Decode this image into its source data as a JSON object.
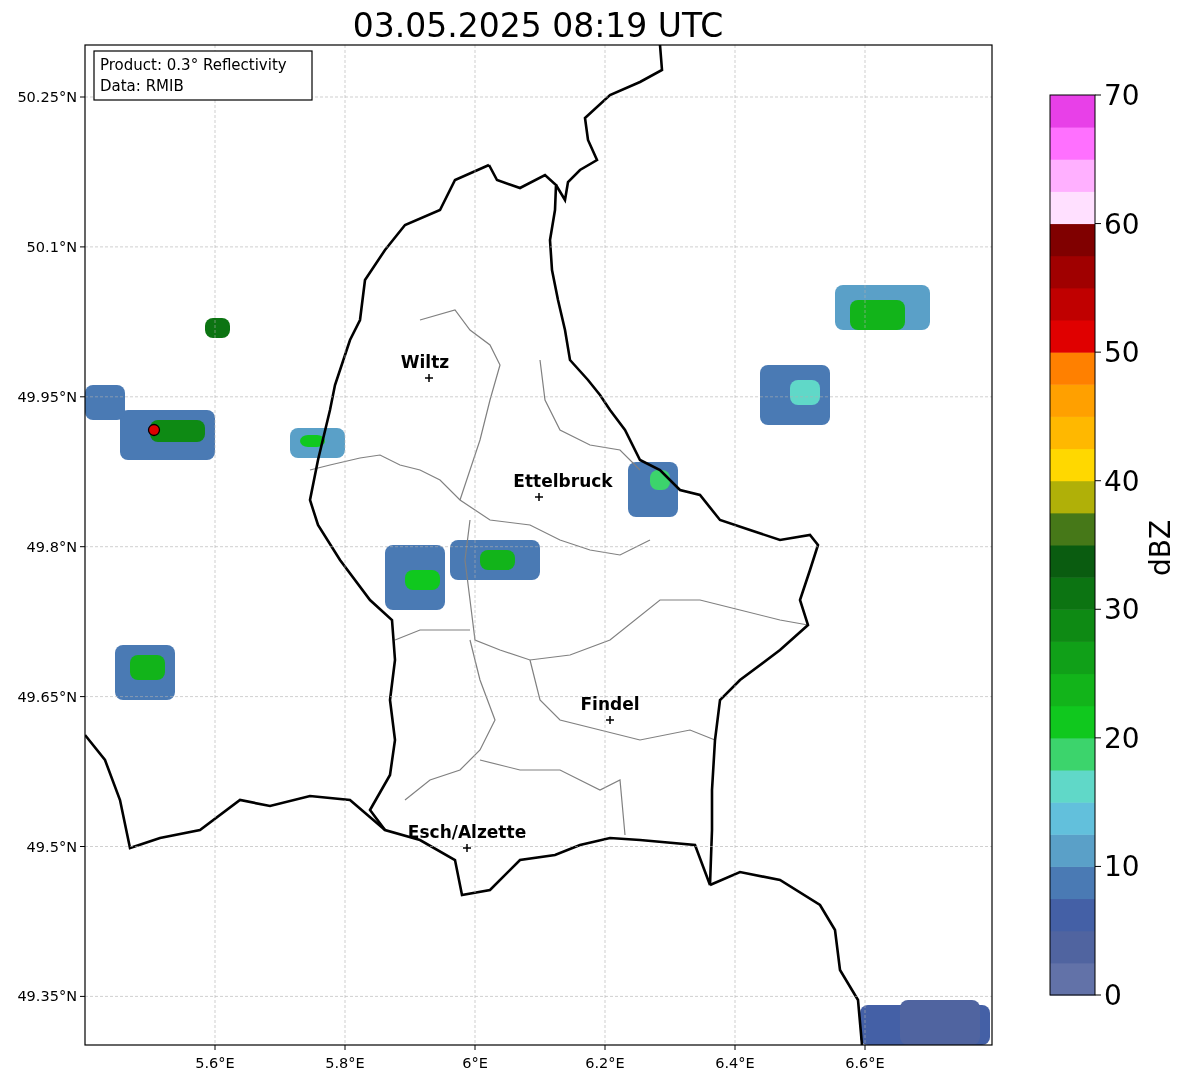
{
  "title": "03.05.2025 08:19 UTC",
  "info_box": [
    "Product: 0.3° Reflectivity",
    "Data: RMIB"
  ],
  "map": {
    "lat_ticks": [
      "50.25°N",
      "50.1°N",
      "49.95°N",
      "49.8°N",
      "49.65°N",
      "49.5°N",
      "49.35°N"
    ],
    "lon_ticks": [
      "5.6°E",
      "5.8°E",
      "6°E",
      "6.2°E",
      "6.4°E",
      "6.6°E"
    ],
    "cities": [
      {
        "name": "Wiltz"
      },
      {
        "name": "Ettelbruck"
      },
      {
        "name": "Findel"
      },
      {
        "name": "Esch/Alzette"
      }
    ]
  },
  "colorbar": {
    "label": "dBZ",
    "ticks": [
      "70",
      "60",
      "50",
      "40",
      "30",
      "20",
      "10",
      "0"
    ],
    "steps": [
      {
        "color": "#6272a8"
      },
      {
        "color": "#5064a0"
      },
      {
        "color": "#4460a6"
      },
      {
        "color": "#4a7ab4"
      },
      {
        "color": "#5aa0c8"
      },
      {
        "color": "#62c0dc"
      },
      {
        "color": "#60d8c8"
      },
      {
        "color": "#3cd46c"
      },
      {
        "color": "#10c81e"
      },
      {
        "color": "#12b41a"
      },
      {
        "color": "#10a018"
      },
      {
        "color": "#0e8a14"
      },
      {
        "color": "#0c7412"
      },
      {
        "color": "#0a5c10"
      },
      {
        "color": "#467818"
      },
      {
        "color": "#b0b008"
      },
      {
        "color": "#ffd800"
      },
      {
        "color": "#ffb800"
      },
      {
        "color": "#ffa000"
      },
      {
        "color": "#ff8000"
      },
      {
        "color": "#e00000"
      },
      {
        "color": "#c00000"
      },
      {
        "color": "#a00000"
      },
      {
        "color": "#800000"
      },
      {
        "color": "#ffe0ff"
      },
      {
        "color": "#ffb0ff"
      },
      {
        "color": "#ff70ff"
      },
      {
        "color": "#e840e8"
      }
    ]
  }
}
